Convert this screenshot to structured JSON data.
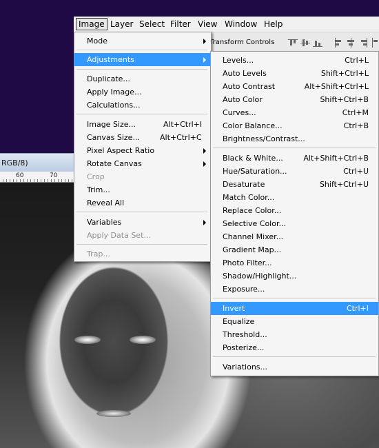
{
  "menubar": {
    "items": [
      {
        "label": "Image"
      },
      {
        "label": "Layer"
      },
      {
        "label": "Select"
      },
      {
        "label": "Filter"
      },
      {
        "label": "View"
      },
      {
        "label": "Window"
      },
      {
        "label": "Help"
      }
    ]
  },
  "options_bar": {
    "transform_controls_label": "Transform Controls"
  },
  "document": {
    "title_fragment": "RGB/8)",
    "ruler_marks": [
      "60",
      "70"
    ]
  },
  "image_menu": {
    "items": {
      "mode": "Mode",
      "adjustments": "Adjustments",
      "duplicate": "Duplicate...",
      "apply_image": "Apply Image...",
      "calculations": "Calculations...",
      "image_size": "Image Size...",
      "image_size_sc": "Alt+Ctrl+I",
      "canvas_size": "Canvas Size...",
      "canvas_size_sc": "Alt+Ctrl+C",
      "pixel_aspect": "Pixel Aspect Ratio",
      "rotate_canvas": "Rotate Canvas",
      "crop": "Crop",
      "trim": "Trim...",
      "reveal_all": "Reveal All",
      "variables": "Variables",
      "apply_data_set": "Apply Data Set...",
      "trap": "Trap..."
    }
  },
  "adjustments_menu": {
    "items": [
      {
        "label": "Levels...",
        "sc": "Ctrl+L"
      },
      {
        "label": "Auto Levels",
        "sc": "Shift+Ctrl+L"
      },
      {
        "label": "Auto Contrast",
        "sc": "Alt+Shift+Ctrl+L"
      },
      {
        "label": "Auto Color",
        "sc": "Shift+Ctrl+B"
      },
      {
        "label": "Curves...",
        "sc": "Ctrl+M"
      },
      {
        "label": "Color Balance...",
        "sc": "Ctrl+B"
      },
      {
        "label": "Brightness/Contrast...",
        "sc": ""
      },
      {
        "label": "Black & White...",
        "sc": "Alt+Shift+Ctrl+B"
      },
      {
        "label": "Hue/Saturation...",
        "sc": "Ctrl+U"
      },
      {
        "label": "Desaturate",
        "sc": "Shift+Ctrl+U"
      },
      {
        "label": "Match Color...",
        "sc": ""
      },
      {
        "label": "Replace Color...",
        "sc": ""
      },
      {
        "label": "Selective Color...",
        "sc": ""
      },
      {
        "label": "Channel Mixer...",
        "sc": ""
      },
      {
        "label": "Gradient Map...",
        "sc": ""
      },
      {
        "label": "Photo Filter...",
        "sc": ""
      },
      {
        "label": "Shadow/Highlight...",
        "sc": ""
      },
      {
        "label": "Exposure...",
        "sc": ""
      },
      {
        "label": "Invert",
        "sc": "Ctrl+I"
      },
      {
        "label": "Equalize",
        "sc": ""
      },
      {
        "label": "Threshold...",
        "sc": ""
      },
      {
        "label": "Posterize...",
        "sc": ""
      },
      {
        "label": "Variations...",
        "sc": ""
      }
    ]
  },
  "colors": {
    "highlight": "#3399ff",
    "desktop": "#1f0a45"
  }
}
